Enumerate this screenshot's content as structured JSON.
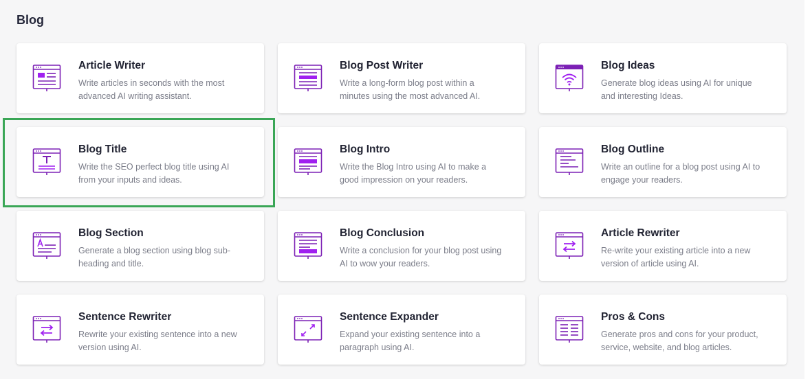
{
  "section": {
    "title": "Blog"
  },
  "colors": {
    "accent": "#7c20b5",
    "accent_fill": "#a020f0",
    "highlight": "#3aa656"
  },
  "cards": [
    {
      "name": "Article Writer",
      "description": "Write articles in seconds with the most advanced AI writing assistant.",
      "icon": "article-writer-icon"
    },
    {
      "name": "Blog Post Writer",
      "description": "Write a long-form blog post within a minutes using the most advanced AI.",
      "icon": "blog-post-writer-icon"
    },
    {
      "name": "Blog Ideas",
      "description": "Generate blog ideas using AI for unique and interesting Ideas.",
      "icon": "wifi-icon"
    },
    {
      "name": "Blog Title",
      "description": "Write the SEO perfect blog title using AI from your inputs and ideas.",
      "icon": "title-t-icon"
    },
    {
      "name": "Blog Intro",
      "description": "Write the Blog Intro using AI to make a good impression on your readers.",
      "icon": "blog-intro-icon"
    },
    {
      "name": "Blog Outline",
      "description": "Write an outline for a blog post using AI to engage your readers.",
      "icon": "outline-icon"
    },
    {
      "name": "Blog Section",
      "description": "Generate a blog section using blog sub-heading and title.",
      "icon": "section-a-icon"
    },
    {
      "name": "Blog Conclusion",
      "description": "Write a conclusion for your blog post using AI to wow your readers.",
      "icon": "conclusion-icon"
    },
    {
      "name": "Article Rewriter",
      "description": "Re-write your existing article into a new version of article using AI.",
      "icon": "swap-arrows-icon"
    },
    {
      "name": "Sentence Rewriter",
      "description": "Rewrite your existing sentence into a new version using AI.",
      "icon": "swap-arrows-icon"
    },
    {
      "name": "Sentence Expander",
      "description": "Expand your existing sentence into a paragraph using AI.",
      "icon": "expand-arrows-icon"
    },
    {
      "name": "Pros & Cons",
      "description": "Generate pros and cons for your product, service, website, and blog articles.",
      "icon": "pros-cons-icon"
    }
  ]
}
